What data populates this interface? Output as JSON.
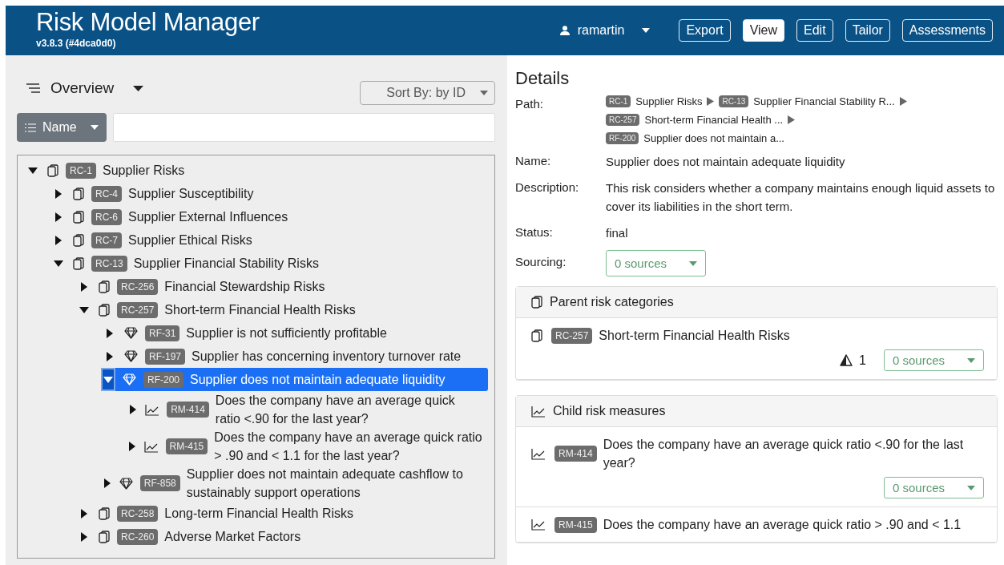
{
  "header": {
    "title": "Risk Model Manager",
    "version": "v3.8.3 (#4dca0d0)",
    "user": "ramartin",
    "buttons": [
      {
        "label": "Export",
        "selected": false
      },
      {
        "label": "View",
        "selected": true
      },
      {
        "label": "Edit",
        "selected": false
      },
      {
        "label": "Tailor",
        "selected": false
      },
      {
        "label": "Assessments",
        "selected": false
      }
    ]
  },
  "overview": {
    "title": "Overview",
    "sort": "Sort By: by ID",
    "filter_field": "Name",
    "tree": [
      {
        "id": "RC-1",
        "label": "Supplier Risks",
        "kind": "category",
        "expanded": true,
        "selected": false,
        "children": [
          {
            "id": "RC-4",
            "label": "Supplier Susceptibility",
            "kind": "category",
            "expanded": false,
            "selected": false
          },
          {
            "id": "RC-6",
            "label": "Supplier External Influences",
            "kind": "category",
            "expanded": false,
            "selected": false
          },
          {
            "id": "RC-7",
            "label": "Supplier Ethical Risks",
            "kind": "category",
            "expanded": false,
            "selected": false
          },
          {
            "id": "RC-13",
            "label": "Supplier Financial Stability Risks",
            "kind": "category",
            "expanded": true,
            "selected": false,
            "children": [
              {
                "id": "RC-256",
                "label": "Financial Stewardship Risks",
                "kind": "category",
                "expanded": false,
                "selected": false
              },
              {
                "id": "RC-257",
                "label": "Short-term Financial Health Risks",
                "kind": "category",
                "expanded": true,
                "selected": false,
                "children": [
                  {
                    "id": "RF-31",
                    "label": "Supplier is not sufficiently profitable",
                    "kind": "factor",
                    "expanded": false,
                    "selected": false
                  },
                  {
                    "id": "RF-197",
                    "label": "Supplier has concerning inventory turnover rate",
                    "kind": "factor",
                    "expanded": false,
                    "selected": false
                  },
                  {
                    "id": "RF-200",
                    "label": "Supplier does not maintain adequate liquidity",
                    "kind": "factor",
                    "expanded": true,
                    "selected": true,
                    "children": [
                      {
                        "id": "RM-414",
                        "label": "Does the company have an average quick ratio <.90 for the last year?",
                        "kind": "measure",
                        "expanded": false,
                        "selected": false
                      },
                      {
                        "id": "RM-415",
                        "label": "Does the company have an average quick ratio > .90 and < 1.1 for the last year?",
                        "kind": "measure",
                        "expanded": false,
                        "selected": false
                      }
                    ]
                  },
                  {
                    "id": "RF-858",
                    "label": "Supplier does not maintain adequate cashflow to sustainably support operations",
                    "kind": "factor",
                    "expanded": false,
                    "selected": false
                  }
                ]
              },
              {
                "id": "RC-258",
                "label": "Long-term Financial Health Risks",
                "kind": "category",
                "expanded": false,
                "selected": false
              },
              {
                "id": "RC-260",
                "label": "Adverse Market Factors",
                "kind": "category",
                "expanded": false,
                "selected": false
              }
            ]
          }
        ]
      }
    ]
  },
  "details": {
    "title": "Details",
    "path_label": "Path:",
    "path": [
      {
        "id": "RC-1",
        "label": "Supplier Risks"
      },
      {
        "id": "RC-13",
        "label": "Supplier Financial Stability R..."
      },
      {
        "id": "RC-257",
        "label": "Short-term Financial Health ..."
      },
      {
        "id": "RF-200",
        "label": "Supplier does not maintain a..."
      }
    ],
    "fields": [
      {
        "label": "Name:",
        "value": "Supplier does not maintain adequate liquidity"
      },
      {
        "label": "Description:",
        "value": "This risk considers whether a company maintains enough liquid assets to cover its liabilities in the short term."
      },
      {
        "label": "Status:",
        "value": "final"
      }
    ],
    "sourcing": {
      "label": "Sourcing:",
      "value": "0 sources"
    },
    "sections": [
      {
        "title": "Parent risk categories",
        "kind": "category",
        "items": [
          {
            "id": "RC-257",
            "label": "Short-term Financial Health Risks",
            "warnings": "1",
            "sources": "0 sources"
          }
        ]
      },
      {
        "title": "Child risk measures",
        "kind": "measure",
        "items": [
          {
            "id": "RM-414",
            "label": "Does the company have an average quick ratio <.90 for the last year?",
            "sources": "0 sources"
          },
          {
            "id": "RM-415",
            "label": "Does the company have an average quick ratio > .90 and < 1.1"
          }
        ]
      }
    ]
  }
}
